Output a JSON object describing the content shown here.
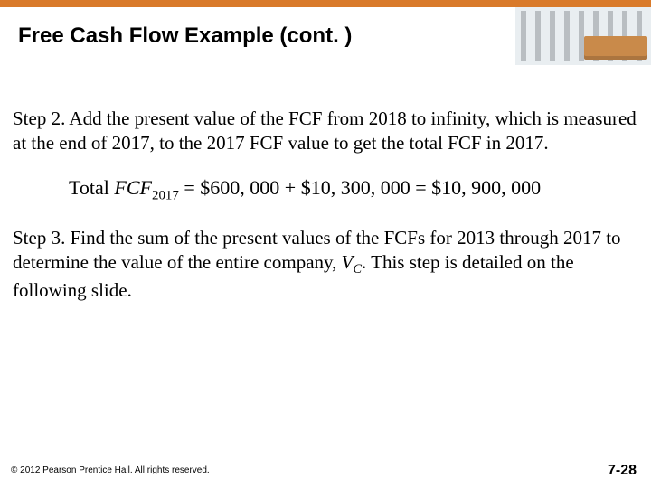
{
  "header": {
    "title": "Free Cash Flow Example (cont. )"
  },
  "body": {
    "step2": "Step 2. Add the present value of the FCF from 2018 to infinity, which is measured at the end of 2017, to the 2017 FCF value to get the total FCF in 2017.",
    "equation": {
      "lead": "Total ",
      "varname": "FCF",
      "varsub": "2017",
      "eq1": " = $600, 000 + $10, 300, 000 = $10, 900, 000"
    },
    "step3_a": "Step 3. Find the sum of the present values of the FCFs for 2013 through 2017 to determine the value of the entire company, ",
    "step3_var": "V",
    "step3_sub": "C",
    "step3_b": ". This step is detailed on the following slide."
  },
  "footer": {
    "copyright": "© 2012 Pearson Prentice Hall. All rights reserved.",
    "page": "7-28"
  }
}
